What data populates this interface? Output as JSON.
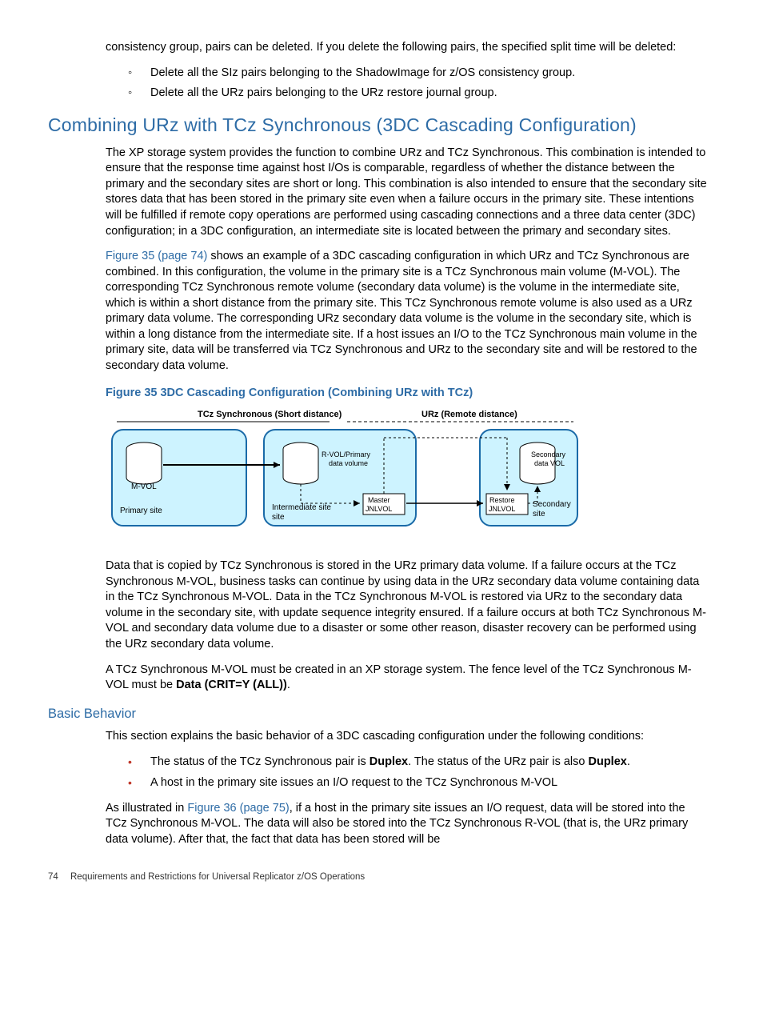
{
  "intro": {
    "p1": "consistency group, pairs can be deleted. If you delete the following pairs, the specified split time will be deleted:",
    "sub": [
      "Delete all the SIz pairs belonging to the ShadowImage for z/OS consistency group.",
      "Delete all the URz pairs belonging to the URz restore journal group."
    ]
  },
  "h2": "Combining URz with TCz Synchronous (3DC Cascading Configuration)",
  "sec1": {
    "p1": "The XP storage system provides the function to combine URz and TCz Synchronous. This combination is intended to ensure that the response time against host I/Os is comparable, regardless of whether the distance between the primary and the secondary sites are short or long. This combination is also intended to ensure that the secondary site stores data that has been stored in the primary site even when a failure occurs in the primary site. These intentions will be fulfilled if remote copy operations are performed using cascading connections and a three data center (3DC) configuration; in a 3DC configuration, an intermediate site is located between the primary and secondary sites.",
    "link1": "Figure 35 (page 74)",
    "p2_after": " shows an example of a 3DC cascading configuration in which URz and TCz Synchronous are combined. In this configuration, the volume in the primary site is a TCz Synchronous main volume (M-VOL). The corresponding TCz Synchronous remote volume (secondary data volume) is the volume in the intermediate site, which is within a short distance from the primary site. This TCz Synchronous remote volume is also used as a URz primary data volume. The corresponding URz secondary data volume is the volume in the secondary site, which is within a long distance from the intermediate site. If a host issues an I/O to the TCz Synchronous main volume in the primary site, data will be transferred via TCz Synchronous and URz to the secondary site and will be restored to the secondary data volume."
  },
  "fig35_caption": "Figure 35 3DC Cascading Configuration (Combining URz with TCz)",
  "diagram": {
    "tcz_label": "TCz Synchronous (Short distance)",
    "urz_label": "URz (Remote distance)",
    "mvol": "M-VOL",
    "primary_site": "Primary site",
    "rvol": "R-VOL/Primary data volume",
    "intermediate": "Intermediate site",
    "master_jnl": "Master JNLVOL",
    "restore_jnl": "Restore JNLVOL",
    "secondary_vol": "Secondary data VOL",
    "secondary_site": "Secondary site"
  },
  "sec2": {
    "p1": "Data that is copied by TCz Synchronous is stored in the URz primary data volume. If a failure occurs at the TCz Synchronous M-VOL, business tasks can continue by using data in the URz secondary data volume containing data in the TCz Synchronous M-VOL. Data in the TCz Synchronous M-VOL is restored via URz to the secondary data volume in the secondary site, with update sequence integrity ensured. If a failure occurs at both TCz Synchronous M-VOL and secondary data volume due to a disaster or some other reason, disaster recovery can be performed using the URz secondary data volume.",
    "p2_a": "A TCz Synchronous M-VOL must be created in an XP storage system. The fence level of the TCz Synchronous M-VOL must be ",
    "p2_bold": "Data (CRIT=Y (ALL))",
    "p2_b": "."
  },
  "h3": "Basic Behavior",
  "sec3": {
    "p1": "This section explains the basic behavior of a 3DC cascading configuration under the following conditions:",
    "bullets": [
      {
        "a": "The status of the TCz Synchronous pair is ",
        "b1": "Duplex",
        "c": ". The status of the URz pair is also ",
        "b2": "Duplex",
        "d": "."
      },
      {
        "a": "A host in the primary site issues an I/O request to the TCz Synchronous M-VOL",
        "b1": "",
        "c": "",
        "b2": "",
        "d": ""
      }
    ],
    "p2_a": "As illustrated in ",
    "link2": "Figure 36 (page 75)",
    "p2_b": ", if a host in the primary site issues an I/O request, data will be stored into the TCz Synchronous M-VOL. The data will also be stored into the TCz Synchronous R-VOL (that is, the URz primary data volume). After that, the fact that data has been stored will be"
  },
  "footer": {
    "page": "74",
    "title": "Requirements and Restrictions for Universal Replicator z/OS Operations"
  }
}
